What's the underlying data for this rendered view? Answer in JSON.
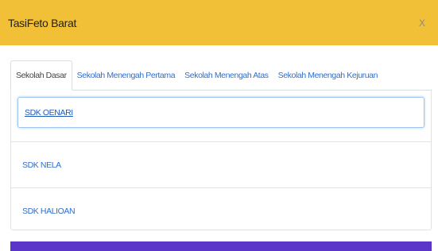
{
  "modal": {
    "title": "TasiFeto Barat",
    "close_label": "X"
  },
  "tabs": [
    {
      "label": "Sekolah Dasar",
      "active": true
    },
    {
      "label": "Sekolah Menengah Pertama",
      "active": false
    },
    {
      "label": "Sekolah Menengah Atas",
      "active": false
    },
    {
      "label": "Sekolah Menengah Kejuruan",
      "active": false
    }
  ],
  "schools": [
    {
      "label": "SDK OENARI"
    },
    {
      "label": "SDK NELA"
    },
    {
      "label": "SDK HALIOAN"
    }
  ],
  "colors": {
    "header_bg": "#f2c037",
    "link": "#2a6fd6",
    "footer_bar": "#5b35c9"
  }
}
